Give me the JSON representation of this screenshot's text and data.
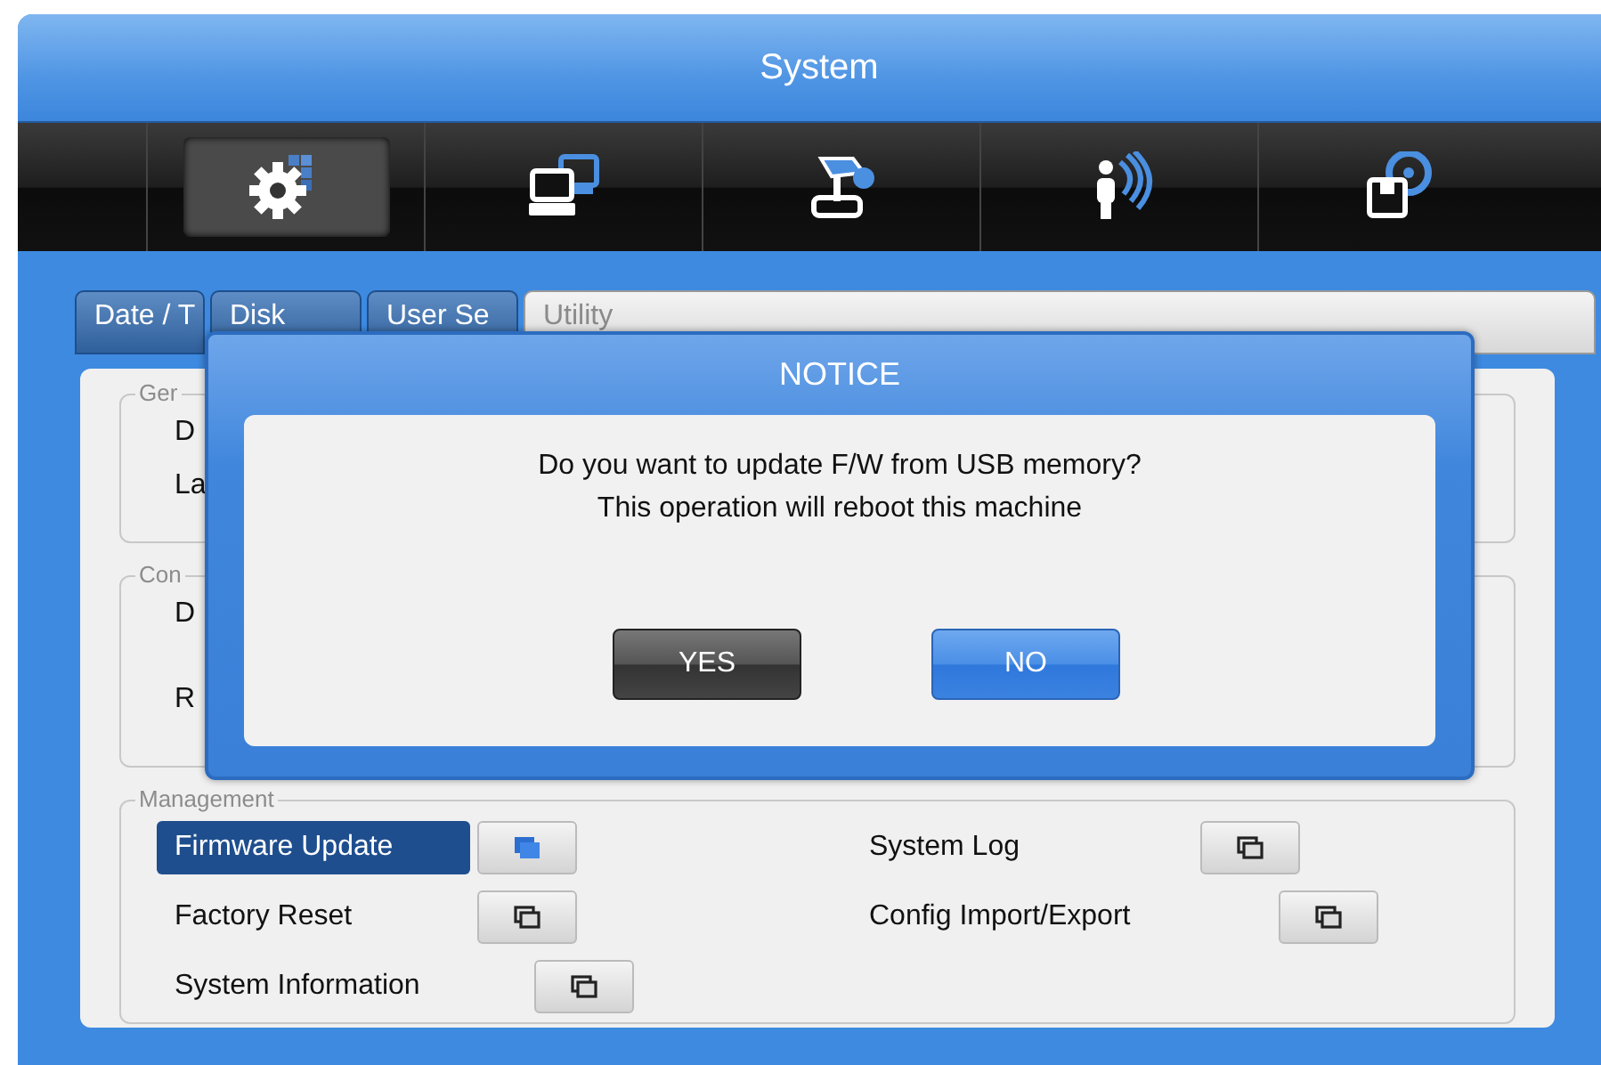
{
  "window": {
    "title": "System"
  },
  "toolbar": [
    {
      "selected": true
    },
    {
      "selected": false
    },
    {
      "selected": false
    },
    {
      "selected": false
    },
    {
      "selected": false
    }
  ],
  "tabs": [
    {
      "label": "Date / T",
      "selected": false
    },
    {
      "label": "Disk",
      "selected": false
    },
    {
      "label": "User Se",
      "selected": false
    },
    {
      "label": "Utility",
      "selected": true
    }
  ],
  "groups": [
    {
      "legend": "Ger",
      "items": [
        "D",
        "La"
      ]
    },
    {
      "legend": "Con",
      "items": [
        "D",
        "R"
      ]
    }
  ],
  "management": {
    "legend": "Management",
    "left_items": [
      {
        "label": "Firmware Update",
        "selected": true
      },
      {
        "label": "Factory Reset",
        "selected": false
      },
      {
        "label": "System Information",
        "selected": false
      }
    ],
    "right_items": [
      {
        "label": "System Log",
        "selected": false
      },
      {
        "label": "Config Import/Export",
        "selected": false
      }
    ]
  },
  "dialog": {
    "title": "NOTICE",
    "lines": [
      "Do you want to update F/W from USB memory?",
      "This operation will reboot this machine"
    ],
    "buttons": [
      {
        "label": "YES",
        "kind": "dark"
      },
      {
        "label": "NO",
        "kind": "blue"
      }
    ]
  }
}
